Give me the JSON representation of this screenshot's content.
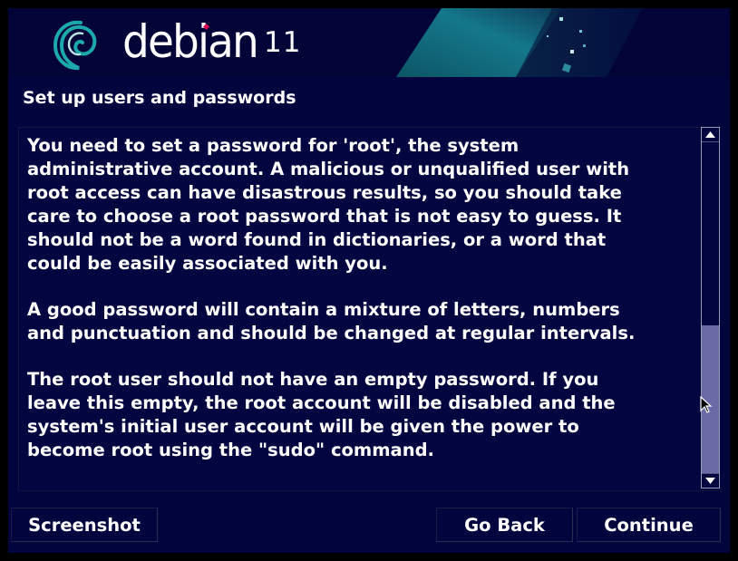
{
  "banner": {
    "brand": "debian",
    "version": "11"
  },
  "page": {
    "title": "Set up users and passwords"
  },
  "body": {
    "paragraphs": [
      "You need to set a password for 'root', the system\nadministrative account. A malicious or unqualified user with\nroot access can have disastrous results, so you should take\ncare to choose a root password that is not easy to guess. It\nshould not be a word found in dictionaries, or a word that\ncould be easily associated with you.",
      "A good password will contain a mixture of letters, numbers\nand punctuation and should be changed at regular intervals.",
      "The root user should not have an empty password. If you\nleave this empty, the root account will be disabled and the\nsystem's initial user account will be given the power to\nbecome root using the \"sudo\" command."
    ]
  },
  "buttons": {
    "screenshot": "Screenshot",
    "go_back": "Go Back",
    "continue": "Continue"
  },
  "scrollbar": {
    "position_fraction": 0.6
  },
  "colors": {
    "background": "#02043d",
    "banner_accent": "#1aa3a3",
    "logo_red": "#d70751",
    "scroll_thumb": "#6a6aa6"
  }
}
